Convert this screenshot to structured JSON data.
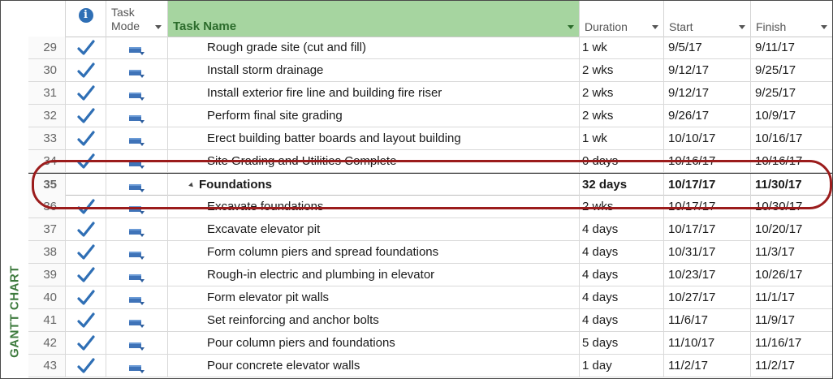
{
  "side_label": "GANTT CHART",
  "header": {
    "task_mode": "Task Mode",
    "task_name": "Task Name",
    "duration": "Duration",
    "start": "Start",
    "finish": "Finish"
  },
  "colors": {
    "header_highlight": "#a6d5a0",
    "check": "#2f6fb5",
    "oval": "#9b1c1c",
    "side_label": "#3d7a3d"
  },
  "rows": [
    {
      "id": "29",
      "complete": true,
      "summary": false,
      "name": "Rough grade site (cut and fill)",
      "duration": "1 wk",
      "start": "9/5/17",
      "finish": "9/11/17"
    },
    {
      "id": "30",
      "complete": true,
      "summary": false,
      "name": "Install storm drainage",
      "duration": "2 wks",
      "start": "9/12/17",
      "finish": "9/25/17"
    },
    {
      "id": "31",
      "complete": true,
      "summary": false,
      "name": "Install exterior fire line and building fire riser",
      "duration": "2 wks",
      "start": "9/12/17",
      "finish": "9/25/17"
    },
    {
      "id": "32",
      "complete": true,
      "summary": false,
      "name": "Perform final site grading",
      "duration": "2 wks",
      "start": "9/26/17",
      "finish": "10/9/17"
    },
    {
      "id": "33",
      "complete": true,
      "summary": false,
      "name": "Erect building batter boards and layout building",
      "duration": "1 wk",
      "start": "10/10/17",
      "finish": "10/16/17"
    },
    {
      "id": "34",
      "complete": true,
      "summary": false,
      "name": "Site Grading and Utilities Complete",
      "duration": "0 days",
      "start": "10/16/17",
      "finish": "10/16/17"
    },
    {
      "id": "35",
      "complete": false,
      "summary": true,
      "name": "Foundations",
      "duration": "32 days",
      "start": "10/17/17",
      "finish": "11/30/17"
    },
    {
      "id": "36",
      "complete": true,
      "summary": false,
      "name": "Excavate foundations",
      "duration": "2 wks",
      "start": "10/17/17",
      "finish": "10/30/17"
    },
    {
      "id": "37",
      "complete": true,
      "summary": false,
      "name": "Excavate elevator pit",
      "duration": "4 days",
      "start": "10/17/17",
      "finish": "10/20/17"
    },
    {
      "id": "38",
      "complete": true,
      "summary": false,
      "name": "Form column piers and spread foundations",
      "duration": "4 days",
      "start": "10/31/17",
      "finish": "11/3/17"
    },
    {
      "id": "39",
      "complete": true,
      "summary": false,
      "name": "Rough-in electric and plumbing in elevator",
      "duration": "4 days",
      "start": "10/23/17",
      "finish": "10/26/17"
    },
    {
      "id": "40",
      "complete": true,
      "summary": false,
      "name": "Form elevator pit walls",
      "duration": "4 days",
      "start": "10/27/17",
      "finish": "11/1/17"
    },
    {
      "id": "41",
      "complete": true,
      "summary": false,
      "name": "Set reinforcing and anchor bolts",
      "duration": "4 days",
      "start": "11/6/17",
      "finish": "11/9/17"
    },
    {
      "id": "42",
      "complete": true,
      "summary": false,
      "name": "Pour column piers and foundations",
      "duration": "5 days",
      "start": "11/10/17",
      "finish": "11/16/17"
    },
    {
      "id": "43",
      "complete": true,
      "summary": false,
      "name": "Pour concrete elevator walls",
      "duration": "1 day",
      "start": "11/2/17",
      "finish": "11/2/17"
    }
  ]
}
